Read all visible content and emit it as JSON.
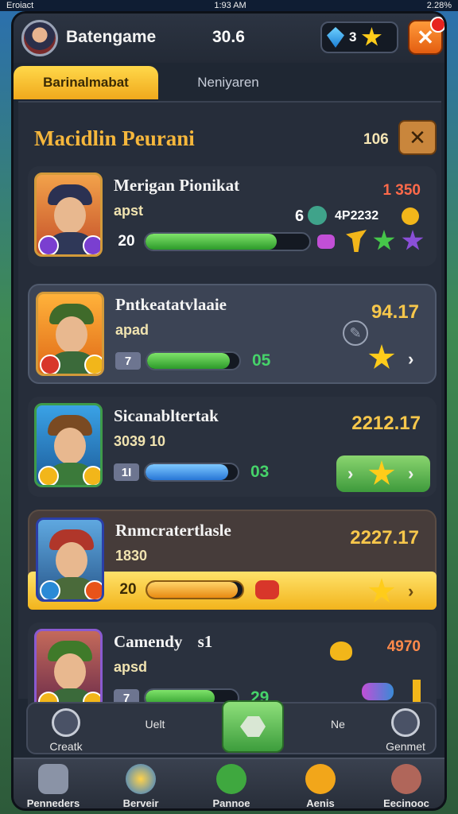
{
  "status": {
    "carrier": "Eroiact",
    "time": "1:93 AM",
    "battery": "2.28%"
  },
  "header": {
    "title": "Batengame",
    "score": "30.6",
    "gems": "3"
  },
  "tabs": [
    {
      "label": "Barinalmabat"
    },
    {
      "label": "Neniyaren"
    }
  ],
  "panel": {
    "title": "Macidlin Peurani",
    "count": "106"
  },
  "rows": [
    {
      "name": "Merigan Pionikat",
      "sub": "apst",
      "value": "1 350",
      "level": "20",
      "progress": 0.8,
      "extra_num": "6",
      "extra_code": "4P2232"
    },
    {
      "name": "Pntkeatatvlaaie",
      "sub": "apad",
      "value": "94.17",
      "level": "7",
      "progress": 0.9,
      "bar_num": "05"
    },
    {
      "name": "Sicanabltertak",
      "sub": "3039 10",
      "value": "2212.17",
      "level": "1I",
      "progress": 0.9,
      "bar_num": "03"
    },
    {
      "name": "Rnmcratertlasle",
      "sub": "1830",
      "value": "2227.17",
      "level": "20",
      "progress": 0.95
    },
    {
      "name": "Camendy",
      "name_suffix": "s1",
      "sub": "apsd",
      "value": "4970",
      "level": "7",
      "progress": 0.75,
      "bar_num": "29"
    }
  ],
  "actions": [
    {
      "label": "Creatk"
    },
    {
      "label": "Uelt"
    },
    {
      "label": "Ne"
    },
    {
      "label": "Genmet"
    }
  ],
  "nav": [
    {
      "label": "Penneders"
    },
    {
      "label": "Berveir"
    },
    {
      "label": "Pannoe"
    },
    {
      "label": "Aenis"
    },
    {
      "label": "Eecinooc"
    }
  ]
}
